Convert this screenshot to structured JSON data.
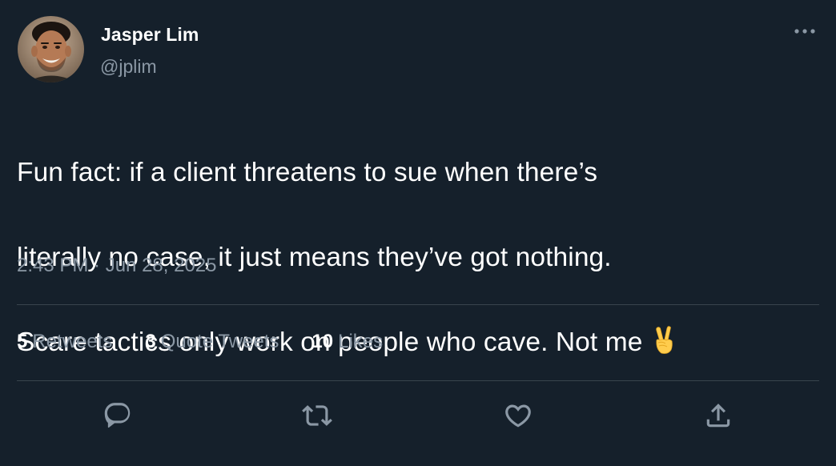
{
  "author": {
    "display_name": "Jasper Lim",
    "handle": "@jplim",
    "avatar_icon": "person-photo-avatar"
  },
  "tweet": {
    "lines": [
      "Fun fact: if a client threatens to sue when there’s",
      "literally no case, it just means they’ve got nothing.",
      "Scare tactics only work on people who cave. Not me"
    ],
    "emoji": "✌️",
    "timestamp": "2:43 PM · Jun 28, 2025"
  },
  "stats": [
    {
      "count": "5",
      "label": "Retweets"
    },
    {
      "count": "3",
      "label": "Quote Tweets"
    },
    {
      "count": "10",
      "label": "Likes"
    }
  ],
  "actions": [
    "reply-icon",
    "retweet-icon",
    "like-icon",
    "share-icon"
  ],
  "colors": {
    "background": "#15202b",
    "primary_text": "#ffffff",
    "secondary_text": "#8b98a5",
    "divider": "#38444d"
  }
}
